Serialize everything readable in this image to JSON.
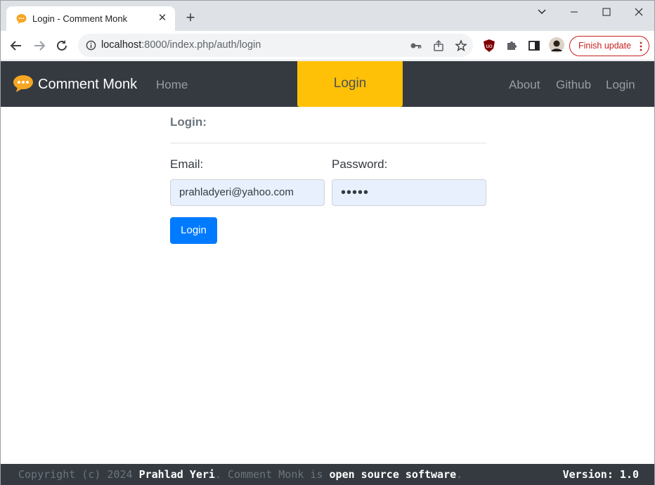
{
  "browser": {
    "tab_title": "Login - Comment Monk",
    "url_host": "localhost",
    "url_rest": ":8000/index.php/auth/login",
    "finish_update_label": "Finish update",
    "tab_close_glyph": "✕",
    "new_tab_glyph": "+",
    "icons": [
      "back-icon",
      "forward-icon",
      "reload-icon",
      "info-icon",
      "key-icon",
      "share-icon",
      "star-icon",
      "ublock-icon",
      "puzzle-icon",
      "sidepanel-icon",
      "avatar",
      "more-icon"
    ]
  },
  "navbar": {
    "brand": "Comment Monk",
    "home": "Home",
    "active": "Login",
    "about": "About",
    "github": "Github",
    "login": "Login",
    "active_color": "#ffc107",
    "bg_color": "#343a40"
  },
  "form": {
    "heading": "Login:",
    "email_label": "Email:",
    "email_value": "prahladyeri@yahoo.com",
    "password_label": "Password:",
    "password_value": "•••••",
    "submit_label": "Login",
    "button_color": "#007bff"
  },
  "footer": {
    "copyright_prefix": "Copyright (c) 2024 ",
    "author": "Prahlad Yeri",
    "middle": ". Comment Monk is ",
    "oss": "open source software",
    "suffix": ".",
    "version": "Version: 1.0"
  }
}
